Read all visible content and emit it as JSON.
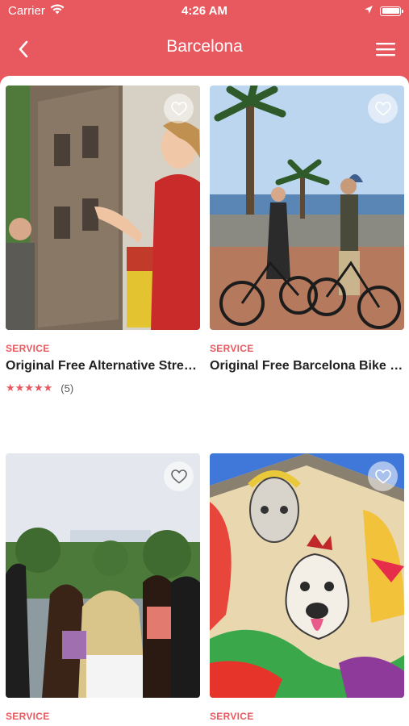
{
  "status": {
    "carrier": "Carrier",
    "time": "4:26 AM"
  },
  "header": {
    "title": "Barcelona"
  },
  "cards": [
    {
      "category": "SERVICE",
      "title": "Original Free Alternative Street Art Tour",
      "stars": "★★★★★",
      "rating_count": "(5)"
    },
    {
      "category": "SERVICE",
      "title": "Original Free Barcelona Bike Tour"
    },
    {
      "category": "SERVICE",
      "title": ""
    },
    {
      "category": "SERVICE",
      "title": ""
    }
  ],
  "colors": {
    "accent": "#e8585f",
    "white": "#ffffff",
    "title": "#222222"
  }
}
